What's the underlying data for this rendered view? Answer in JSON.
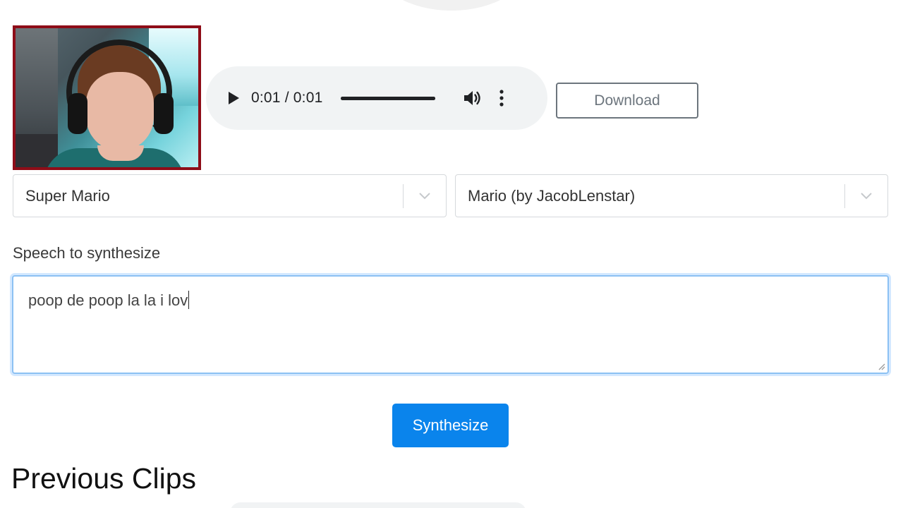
{
  "audio_player": {
    "time_display": "0:01 / 0:01",
    "progress_fraction": 1.0
  },
  "actions": {
    "download_label": "Download",
    "synthesize_label": "Synthesize"
  },
  "selects": {
    "source": {
      "value": "Super Mario"
    },
    "voice": {
      "value": "Mario (by JacobLenstar)"
    }
  },
  "speech": {
    "label": "Speech to synthesize",
    "text": "poop de poop la la i lov"
  },
  "previous_clips": {
    "heading": "Previous Clips"
  },
  "icons": {
    "play": "play-icon",
    "volume": "volume-icon",
    "more": "more-vertical-icon",
    "chevron": "chevron-down-icon",
    "resize": "resize-grip-icon"
  },
  "colors": {
    "primary": "#0a84ec",
    "focus_border": "#8cc1f3",
    "webcam_border": "#8e0d18",
    "player_bg": "#f1f3f4"
  }
}
